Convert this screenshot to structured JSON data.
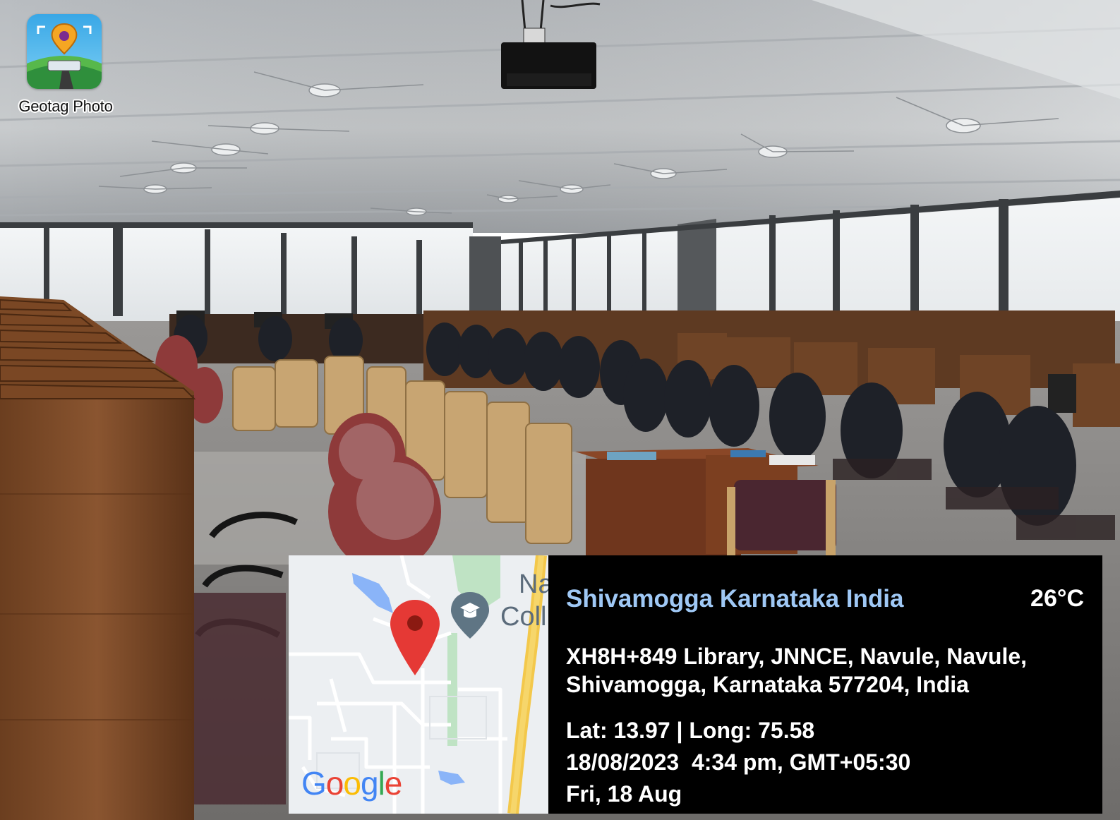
{
  "app_badge": {
    "label": "Geotag Photo",
    "icon": "geotag-photo-app-icon"
  },
  "map": {
    "labels": [
      "Na",
      "Coll"
    ],
    "logo": "Google",
    "icons": [
      "location-pin-icon",
      "college-place-icon"
    ],
    "colors": {
      "pin": "#e53935",
      "road": "#f3c84b",
      "park": "#bfe3c4",
      "water": "#8ab4f8"
    }
  },
  "info": {
    "location_title": "Shivamogga Karnataka India",
    "temperature": "26°C",
    "address_line1": "XH8H+849 Library, JNNCE, Navule, Navule,",
    "address_line2": "Shivamogga, Karnataka 577204, India",
    "lat_long": "Lat: 13.97 | Long: 75.58",
    "datetime": "18/08/2023  4:34 pm, GMT+05:30",
    "day": "Fri, 18 Aug"
  },
  "colors": {
    "panel_bg": "#000000",
    "title": "#9fc8f5",
    "text": "#ffffff"
  }
}
